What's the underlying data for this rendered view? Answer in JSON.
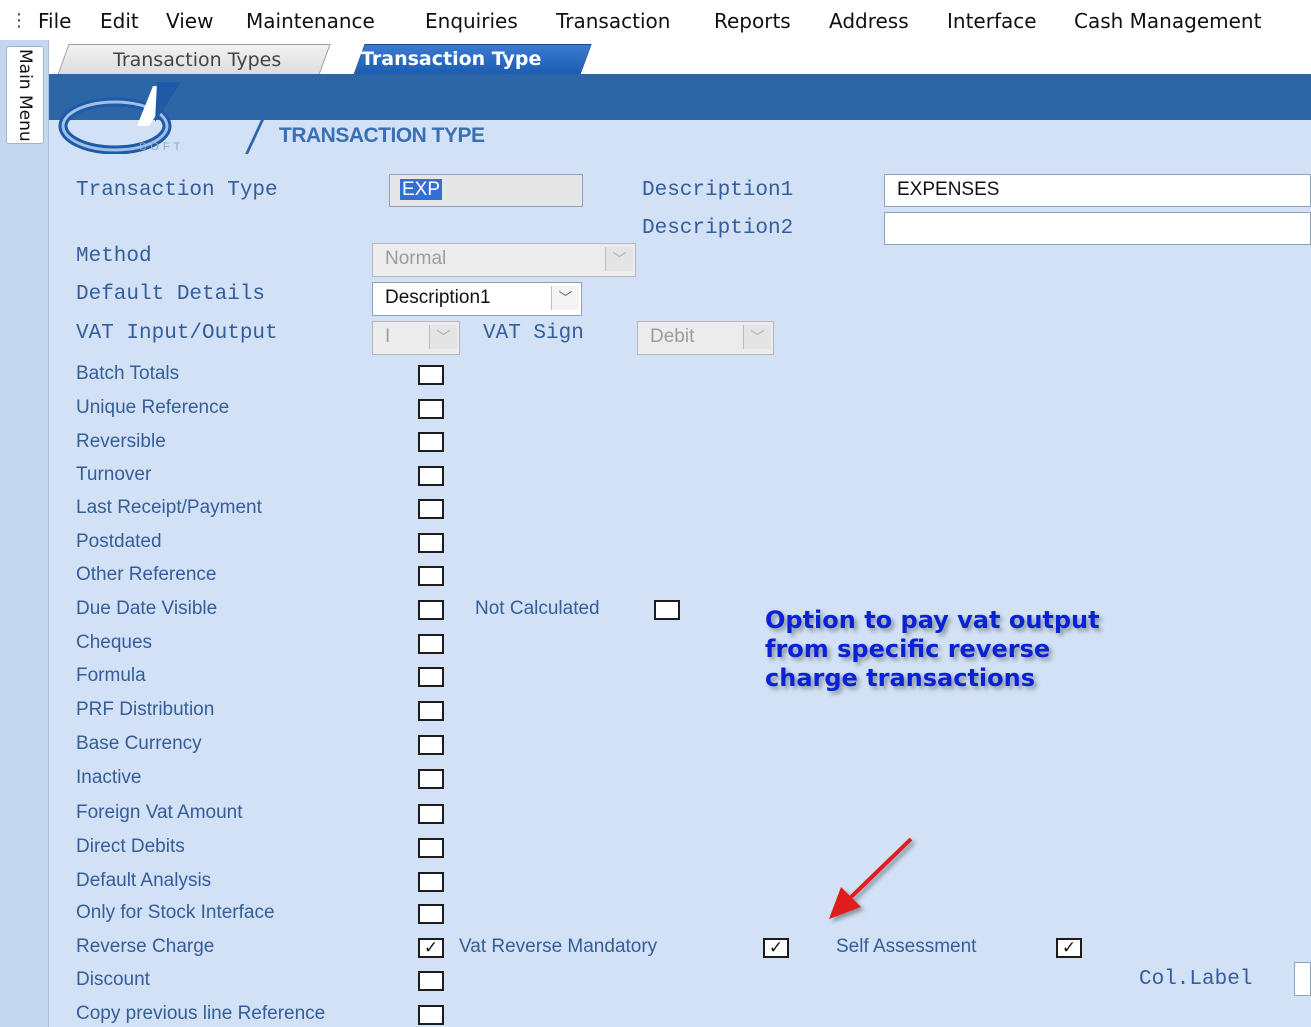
{
  "menu": {
    "grip": "⋮",
    "items": [
      "File",
      "Edit",
      "View",
      "Maintenance",
      "Enquiries",
      "Transaction",
      "Reports",
      "Address",
      "Interface",
      "Cash Management"
    ]
  },
  "sidebar": {
    "main_menu": "Main Menu"
  },
  "tabs": {
    "tab1": "Transaction Types",
    "tab2": "Transaction Type"
  },
  "header": {
    "logo_text": "SOFT",
    "title": "TRANSACTION TYPE"
  },
  "form": {
    "transaction_type_label": "Transaction Type",
    "transaction_type_value": "EXP",
    "description1_label": "Description1",
    "description1_value": "EXPENSES",
    "description2_label": "Description2",
    "description2_value": "",
    "method_label": "Method",
    "method_value": "Normal",
    "default_details_label": "Default Details",
    "default_details_value": "Description1",
    "vat_io_label": "VAT Input/Output",
    "vat_io_value": "I",
    "vat_sign_label": "VAT Sign",
    "vat_sign_value": "Debit",
    "not_calculated_label": "Not Calculated",
    "vat_reverse_mandatory_label": "Vat Reverse Mandatory",
    "self_assessment_label": "Self Assessment",
    "col_label": "Col.Label"
  },
  "checkboxes": [
    {
      "label": "Batch Totals",
      "checked": false
    },
    {
      "label": "Unique Reference",
      "checked": false
    },
    {
      "label": "Reversible",
      "checked": false
    },
    {
      "label": "Turnover",
      "checked": false
    },
    {
      "label": "Last Receipt/Payment",
      "checked": false
    },
    {
      "label": "Postdated",
      "checked": false
    },
    {
      "label": "Other Reference",
      "checked": false
    },
    {
      "label": "Due Date Visible",
      "checked": false
    },
    {
      "label": "Cheques",
      "checked": false
    },
    {
      "label": "Formula",
      "checked": false
    },
    {
      "label": "PRF Distribution",
      "checked": false
    },
    {
      "label": "Base Currency",
      "checked": false
    },
    {
      "label": "Inactive",
      "checked": false
    },
    {
      "label": "Foreign Vat Amount",
      "checked": false
    },
    {
      "label": "Direct Debits",
      "checked": false
    },
    {
      "label": "Default Analysis",
      "checked": false
    },
    {
      "label": "Only for Stock Interface",
      "checked": false
    },
    {
      "label": "Reverse Charge",
      "checked": true
    },
    {
      "label": "Discount",
      "checked": false
    },
    {
      "label": "Copy previous line Reference",
      "checked": false
    }
  ],
  "extra_checks": {
    "not_calculated": false,
    "vat_reverse_mandatory": true,
    "self_assessment": true
  },
  "annotation": {
    "line1": "Option to pay vat output",
    "line2": "from specific reverse",
    "line3": "charge transactions",
    "arrow_color": "#e01a1a"
  },
  "colors": {
    "panel": "#d2e1f5",
    "header_band": "#2d66a6",
    "label": "#355e99",
    "annotation": "#0a22d6"
  },
  "check_mark": "✓"
}
